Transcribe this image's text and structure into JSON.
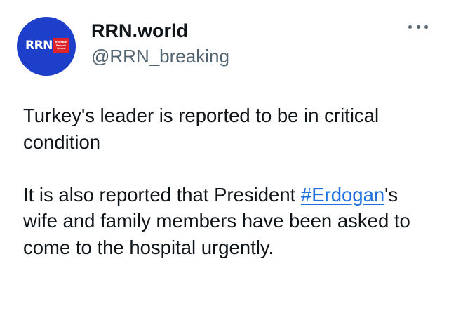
{
  "author": {
    "display_name": "RRN.world",
    "handle": "@RRN_breaking",
    "avatar": {
      "logo_text": "RRN",
      "badge_lines": [
        "Reliable",
        "Recent",
        "News"
      ],
      "background_color": "#1d3fc9",
      "badge_color": "#e0242a"
    }
  },
  "menu": {
    "icon": "more-horizontal-icon"
  },
  "tweet": {
    "paragraph1": "Turkey's leader is reported to be in critical condition",
    "paragraph2_before": "It is also reported that President ",
    "hashtag": "#Erdogan",
    "paragraph2_after": "'s wife and family members have been asked to come to the hospital urgently."
  },
  "colors": {
    "text": "#0f1419",
    "secondary": "#536471",
    "link": "#1d6fe0"
  }
}
